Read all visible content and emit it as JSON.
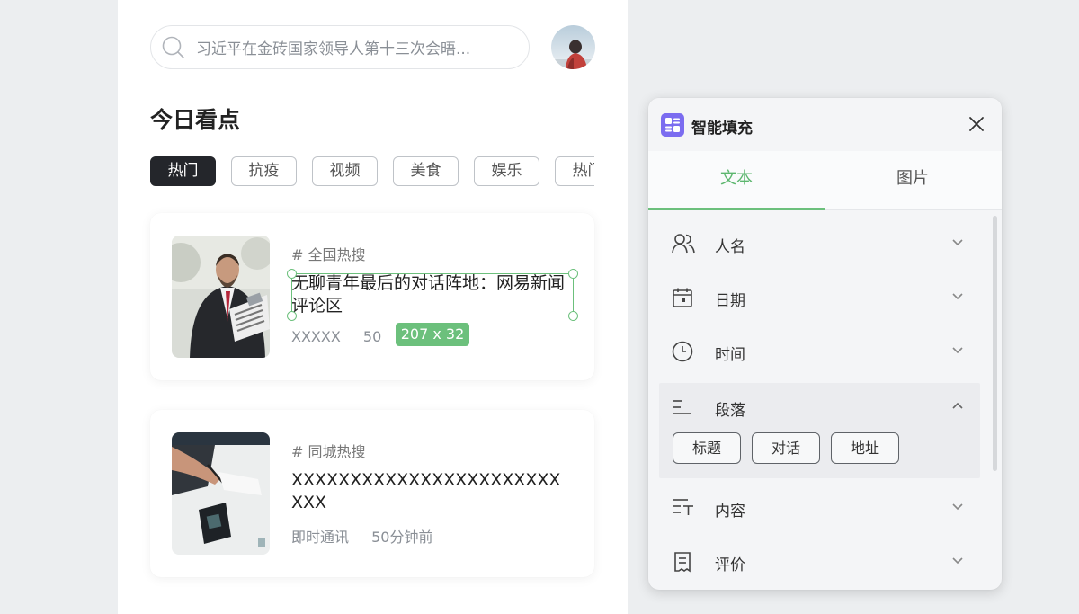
{
  "search": {
    "text": "习近平在金砖国家领导人第十三次会晤..."
  },
  "section_title": "今日看点",
  "tags": [
    "热门",
    "抗疫",
    "视频",
    "美食",
    "娱乐",
    "热门"
  ],
  "cards": [
    {
      "category": "#  全国热搜",
      "title": "无聊青年最后的对话阵地：网易新闻评论区",
      "source": "XXXXX",
      "time": "50"
    },
    {
      "category": "#  同城热搜",
      "title": "XXXXXXXXXXXXXXXXXXXXXXX XXX",
      "source": "即时通讯",
      "time": "50分钟前"
    }
  ],
  "selection": {
    "size_label": "207 x 32"
  },
  "panel": {
    "title": "智能填充",
    "tabs": [
      "文本",
      "图片"
    ],
    "items": [
      {
        "label": "人名",
        "icon": "people-icon"
      },
      {
        "label": "日期",
        "icon": "calendar-icon"
      },
      {
        "label": "时间",
        "icon": "clock-icon"
      },
      {
        "label": "段落",
        "icon": "paragraph-icon",
        "subtags": [
          "标题",
          "对话",
          "地址"
        ]
      },
      {
        "label": "内容",
        "icon": "text-content-icon"
      },
      {
        "label": "评价",
        "icon": "review-icon"
      }
    ]
  },
  "colors": {
    "accent": "#6cc07c",
    "logo": "#7b6cf0",
    "active_tag": "#24262b"
  }
}
